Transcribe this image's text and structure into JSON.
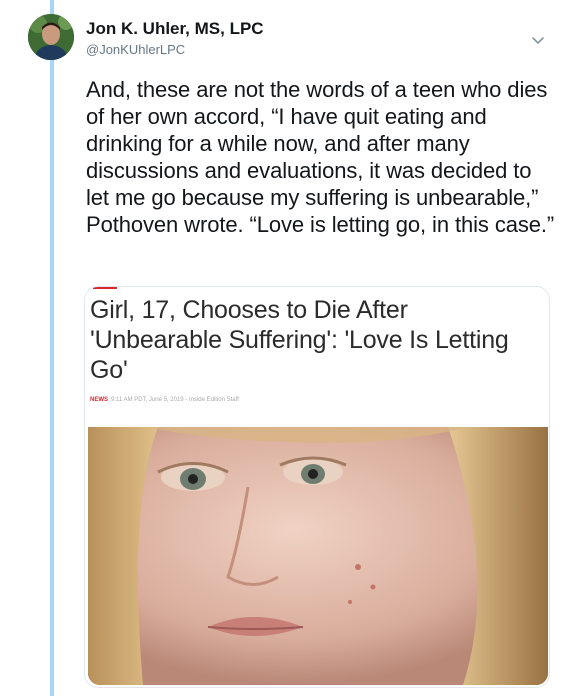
{
  "author": {
    "name": "Jon K. Uhler, MS, LPC",
    "handle": "@JonKUhlerLPC"
  },
  "tweet": {
    "text": "And, these are not the words of a teen who dies of her own accord, “I have quit eating and drinking for a while now, and after many discussions and evaluations, it was decided to let me go because my suffering is unbearable,” Pothoven wrote. “Love is letting go, in this case.”"
  },
  "card": {
    "title": "Girl, 17, Chooses to Die After 'Unbearable Suffering': 'Love Is Letting Go'",
    "tag": "NEWS",
    "meta": "9:11 AM PDT, June 5, 2019 - Inside Edition Staff"
  },
  "icons": {
    "menu": "chevron-down-icon"
  },
  "colors": {
    "thread_line": "#a9d4f5",
    "accent": "#d9252c",
    "text": "#14171a",
    "handle": "#657786"
  }
}
